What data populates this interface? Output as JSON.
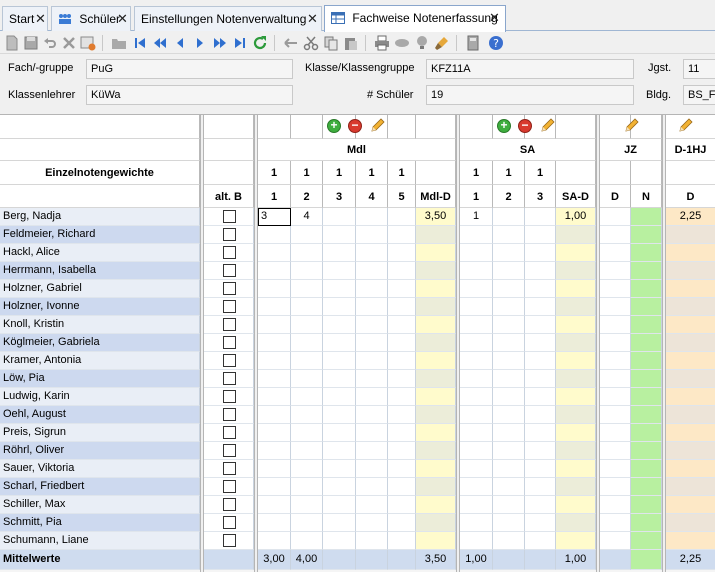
{
  "tabs": [
    {
      "label": "Start"
    },
    {
      "label": "Schüler"
    },
    {
      "label": "Einstellungen Notenverwaltung"
    },
    {
      "label": "Fachweise Notenerfassung"
    }
  ],
  "info": {
    "fach_label": "Fach/-gruppe",
    "fach_value": "PuG",
    "klasse_label": "Klasse/Klassengruppe",
    "klasse_value": "KFZ11A",
    "jgst_label": "Jgst.",
    "jgst_value": "11",
    "lehrer_label": "Klassenlehrer",
    "lehrer_value": "KüWa",
    "schueler_label": "# Schüler",
    "schueler_value": "19",
    "bldg_label": "Bldg.",
    "bldg_value": "BS_Fa"
  },
  "grid": {
    "row_header": "Einzelnotengewichte",
    "altb_label": "alt. B",
    "groups": {
      "mdl": "Mdl",
      "sa": "SA",
      "jz": "JZ",
      "d1hj": "D-1HJ"
    },
    "weights": {
      "w1": "1",
      "w2": "1",
      "w3": "1",
      "w4": "1",
      "w5": "1",
      "s1": "1",
      "s2": "1",
      "s3": "1"
    },
    "cols": {
      "m1": "1",
      "m2": "2",
      "m3": "3",
      "m4": "4",
      "m5": "5",
      "md": "Mdl-D",
      "s1": "1",
      "s2": "2",
      "s3": "3",
      "sd": "SA-D",
      "jd": "D",
      "jn": "N",
      "hd": "D"
    },
    "students": [
      {
        "name": "Berg, Nadja",
        "m1": "3",
        "m2": "4",
        "md": "3,50",
        "s1": "1",
        "sd": "1,00",
        "hd": "2,25"
      },
      {
        "name": "Feldmeier, Richard"
      },
      {
        "name": "Hackl, Alice"
      },
      {
        "name": "Herrmann, Isabella"
      },
      {
        "name": "Holzner, Gabriel"
      },
      {
        "name": "Holzner, Ivonne"
      },
      {
        "name": "Knoll, Kristin"
      },
      {
        "name": "Köglmeier, Gabriela"
      },
      {
        "name": "Kramer, Antonia"
      },
      {
        "name": "Löw, Pia"
      },
      {
        "name": "Ludwig, Karin"
      },
      {
        "name": "Oehl, August"
      },
      {
        "name": "Preis, Sigrun"
      },
      {
        "name": "Röhrl, Oliver"
      },
      {
        "name": "Sauer, Viktoria"
      },
      {
        "name": "Scharl, Friedbert"
      },
      {
        "name": "Schiller, Max"
      },
      {
        "name": "Schmitt, Pia"
      },
      {
        "name": "Schumann, Liane"
      }
    ],
    "footer": {
      "label": "Mittelwerte",
      "m1": "3,00",
      "m2": "4,00",
      "md": "3,50",
      "s1": "1,00",
      "sd": "1,00",
      "hd": "2,25"
    }
  },
  "colors": {
    "name_odd": "#e9eef6",
    "name_even": "#cdd9ef",
    "avg_col": "#fffbcc",
    "avg_col_alt": "#ecedd9",
    "n_col": "#b8f0a0",
    "hj_col": "#fde8c6",
    "hj_col_alt": "#ede4d8",
    "footer": "#cfdcef"
  }
}
